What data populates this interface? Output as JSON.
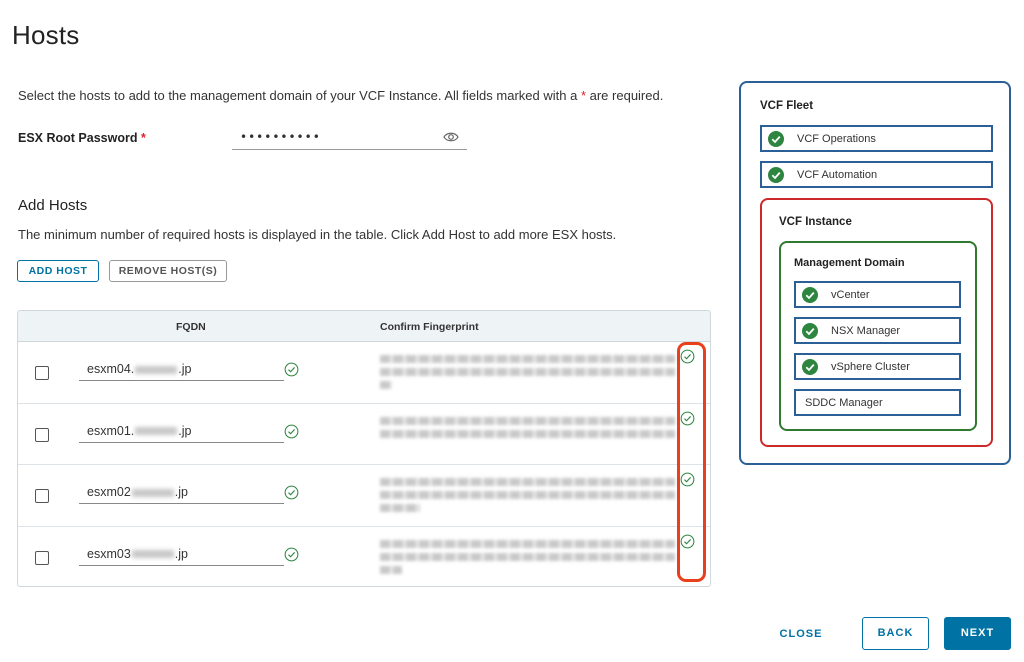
{
  "page": {
    "title": "Hosts"
  },
  "intro": {
    "text_before": "Select the hosts to add to the management domain of your VCF Instance. All fields marked with a",
    "required_mark": "*",
    "text_after": "are required."
  },
  "password": {
    "label": "ESX Root Password",
    "required_mark": "*",
    "value": "••••••••••",
    "icon": "eye-icon"
  },
  "add_hosts": {
    "title": "Add Hosts",
    "description": "The minimum number of required hosts is displayed in the table. Click Add Host to add more ESX hosts.",
    "add_button": "ADD HOST",
    "remove_button": "REMOVE HOST(S)"
  },
  "table": {
    "columns": [
      "FQDN",
      "Confirm Fingerprint"
    ],
    "rows": [
      {
        "fqdn_prefix": "esxm04.",
        "fqdn_suffix": ".jp",
        "fqdn_valid": true,
        "fingerprint_valid": true
      },
      {
        "fqdn_prefix": "esxm01.",
        "fqdn_suffix": ".jp",
        "fqdn_valid": true,
        "fingerprint_valid": true
      },
      {
        "fqdn_prefix": "esxm02",
        "fqdn_suffix": ".jp",
        "fqdn_valid": true,
        "fingerprint_valid": true
      },
      {
        "fqdn_prefix": "esxm03",
        "fqdn_suffix": ".jp",
        "fqdn_valid": true,
        "fingerprint_valid": true
      }
    ]
  },
  "topology": {
    "fleet_title": "VCF Fleet",
    "fleet_items": [
      {
        "label": "VCF Operations",
        "checked": true
      },
      {
        "label": "VCF Automation",
        "checked": true
      }
    ],
    "instance_title": "VCF Instance",
    "domain_title": "Management Domain",
    "domain_items": [
      {
        "label": "vCenter",
        "checked": true
      },
      {
        "label": "NSX Manager",
        "checked": true
      },
      {
        "label": "vSphere Cluster",
        "checked": true
      },
      {
        "label": "SDDC Manager",
        "checked": false
      }
    ]
  },
  "footer": {
    "close": "CLOSE",
    "back": "BACK",
    "next": "NEXT"
  },
  "colors": {
    "accent": "#0072a3",
    "fleet_border": "#2a5f98",
    "instance_border": "#cc2a2a",
    "domain_border": "#2f7a2f",
    "success": "#2e8540",
    "highlight": "#e8401c"
  }
}
